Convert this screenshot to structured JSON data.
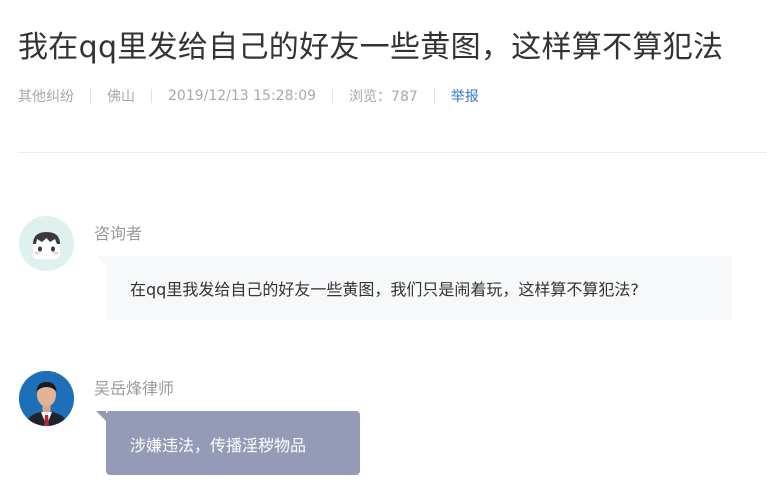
{
  "question": {
    "title": "我在qq里发给自己的好友一些黄图，这样算不算犯法",
    "category": "其他纠纷",
    "city": "佛山",
    "datetime": "2019/12/13 15:28:09",
    "views": "浏览：787",
    "report_label": "举报"
  },
  "thread": [
    {
      "role": "consultant",
      "name": "咨询者",
      "avatar_icon": "cartoon-user-avatar-icon",
      "message": "在qq里我发给自己的好友一些黄图，我们只是闹着玩，这样算不算犯法?"
    },
    {
      "role": "lawyer",
      "name": "吴岳烽律师",
      "avatar_icon": "lawyer-photo-avatar-icon",
      "message": "涉嫌违法，传播淫秽物品"
    }
  ],
  "colors": {
    "question_bubble": "#f7f8fa",
    "answer_bubble": "#959bb6",
    "link": "#3b74c4",
    "meta_text": "#a8a8a8"
  }
}
